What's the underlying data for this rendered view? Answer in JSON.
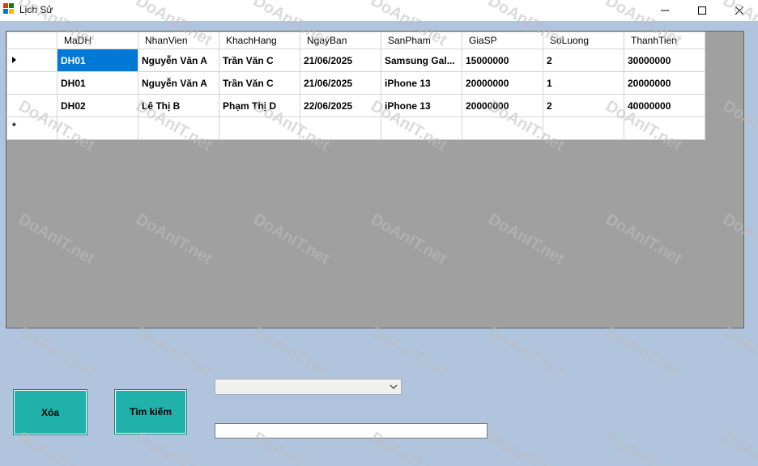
{
  "window": {
    "title": "Lịch Sử",
    "controls": {
      "minimize": "—",
      "maximize": "☐",
      "close": "✕"
    }
  },
  "grid": {
    "columns": [
      "MaDH",
      "NhanVien",
      "KhachHang",
      "NgayBan",
      "SanPham",
      "GiaSP",
      "SoLuong",
      "ThanhTien"
    ],
    "rows": [
      [
        "DH01",
        "Nguyễn Văn A",
        "Trần Văn C",
        "21/06/2025",
        "Samsung Gal...",
        "15000000",
        "2",
        "30000000"
      ],
      [
        "DH01",
        "Nguyễn Văn A",
        "Trần Văn C",
        "21/06/2025",
        "iPhone 13",
        "20000000",
        "1",
        "20000000"
      ],
      [
        "DH02",
        "Lê Thị B",
        "Phạm Thị D",
        "22/06/2025",
        "iPhone 13",
        "20000000",
        "2",
        "40000000"
      ]
    ],
    "selected_row": 0,
    "new_row_marker": "*"
  },
  "buttons": {
    "delete_label": "Xóa",
    "search_label": "Tìm kiếm"
  },
  "combo": {
    "value": ""
  },
  "search_box": {
    "value": ""
  },
  "watermark": {
    "text": "DoAnIT.net"
  },
  "colors": {
    "form_bg": "#b0c4de",
    "grid_bg": "#a0a0a0",
    "button_bg": "#20b2aa",
    "selection": "#0078d7"
  }
}
